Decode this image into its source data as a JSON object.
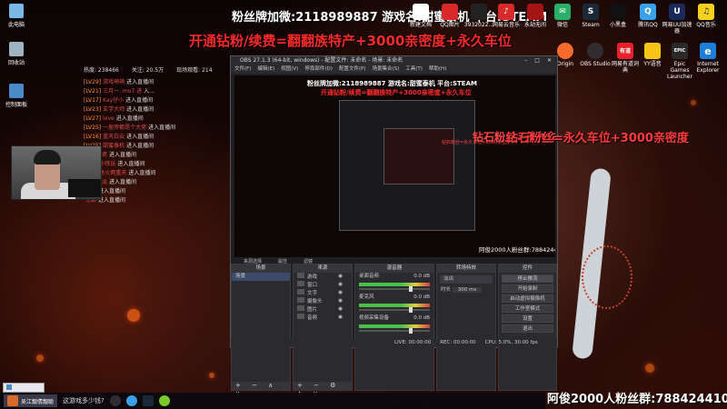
{
  "header": {
    "line1": "粉丝牌加微:2118989887 游戏名:甜蜜泰机 平台:STEAM",
    "line2": "开通钻粉/续费=翻翻族特产+3000亲密度+永久车位"
  },
  "desktop_icons": [
    {
      "label": "此电脑",
      "color": "#7ab8e8"
    },
    {
      "label": "回收站",
      "color": "#9fb3c3"
    },
    {
      "label": "控制面板",
      "color": "#4a8ac8"
    }
  ],
  "app_icons_row1": [
    {
      "label": "新建文档",
      "glyph": "",
      "color": "#ffffff"
    },
    {
      "label": "QQ图片",
      "glyph": "",
      "color": "#d82a2a"
    },
    {
      "label": "3932022...",
      "glyph": "",
      "color": "#222222"
    },
    {
      "label": "网易云音乐",
      "glyph": "♪",
      "color": "#d82a2a"
    },
    {
      "label": "永劫无间",
      "glyph": "",
      "color": "#a31515"
    },
    {
      "label": "微信",
      "glyph": "✉",
      "color": "#2aae67"
    },
    {
      "label": "Steam",
      "glyph": "S",
      "color": "#1b2838"
    },
    {
      "label": "小黑盒",
      "glyph": "",
      "color": "#111111"
    },
    {
      "label": "腾讯QQ",
      "glyph": "Q",
      "color": "#3aa0e8"
    },
    {
      "label": "网易UU加速器",
      "glyph": "U",
      "color": "#1a2a5a"
    },
    {
      "label": "QQ音乐",
      "glyph": "♫",
      "color": "#f5d020"
    }
  ],
  "app_icons_row2": [
    {
      "label": "Origin",
      "glyph": "",
      "color": "#f56c2d"
    },
    {
      "label": "OBS Studio",
      "glyph": "",
      "color": "#302e31"
    },
    {
      "label": "网易有道词典",
      "glyph": "有道",
      "color": "#e8202a"
    },
    {
      "label": "YY语音",
      "glyph": "",
      "color": "#f5c518"
    },
    {
      "label": "Epic Games Launcher",
      "glyph": "EPIC",
      "color": "#2a2a2a"
    },
    {
      "label": "Internet Explorer",
      "glyph": "e",
      "color": "#1e7fd8"
    }
  ],
  "stats": {
    "heat": "热度: 238466",
    "follow": "关注: 20.5万",
    "online": "现场观看: 214"
  },
  "chat": [
    {
      "lvl": "[LV29]",
      "user": "游戏萌萌",
      "msg": "进入直播间"
    },
    {
      "lvl": "[LV21]",
      "user": "三月一. mo7 进",
      "msg": "入..."
    },
    {
      "lvl": "[LV17]",
      "user": "Kay仔小",
      "msg": "进入直播间"
    },
    {
      "lvl": "[LV23]",
      "user": "玄学大师",
      "msg": "进入直播间"
    },
    {
      "lvl": "[LV27]",
      "user": "love",
      "msg": "进入直播间"
    },
    {
      "lvl": "[LV25]",
      "user": "一届帝都是个大佬",
      "msg": "进入直播间"
    },
    {
      "lvl": "[LV16]",
      "user": "蓝天白云",
      "msg": "进入直播间"
    },
    {
      "lvl": "[LV25]",
      "user": "甜蜜泰机",
      "msg": "进入直播间"
    },
    {
      "lvl": "",
      "user": "主播大佬",
      "msg": "进入直播间"
    },
    {
      "lvl": "[LV7]",
      "user": "小铁玩",
      "msg": "进入直播间"
    },
    {
      "lvl": "[LV8]",
      "user": "冰火两重天",
      "msg": "进入直播间"
    },
    {
      "lvl": "",
      "user": "风清云淡",
      "msg": "进入直播间"
    },
    {
      "lvl": "",
      "user": "奶茶",
      "msg": "进入直播间"
    },
    {
      "lvl": "",
      "user": "无聊",
      "msg": "进入直播间"
    }
  ],
  "obs": {
    "title": "OBS 27.1.3 (64-bit, windows) - 配置文件: 未命名 - 场景: 未命名",
    "menu": [
      "文件(F)",
      "编辑(E)",
      "视图(V)",
      "停靠部件(D)",
      "配置文件(P)",
      "场景集合(S)",
      "工具(T)",
      "帮助(H)"
    ],
    "preview_title": "粉丝牌加微:2118989887 游戏名:甜蜜泰机 平台:STEAM",
    "preview_red": "开通钻粉/续费=翻翻族特产+3000亲密度+永久车位",
    "preview_diamond": "钻石粉丝=永久车位+3000亲密度",
    "preview_fans": "阿俊2000人粉丝群:788424410",
    "tabs": [
      "来源选择",
      "属性",
      "滤镜"
    ],
    "scenes_header": "场景",
    "scenes": [
      "场景"
    ],
    "sources_header": "来源",
    "sources": [
      "游戏",
      "窗口",
      "文字",
      "摄像头",
      "图片",
      "音频"
    ],
    "mixer_header": "混音器",
    "mixer_channels": [
      {
        "name": "桌面音频",
        "db": "0.0 dB"
      },
      {
        "name": "麦克风",
        "db": "0.0 dB"
      },
      {
        "name": "视频采集设备",
        "db": "0.0 dB"
      }
    ],
    "transitions_header": "转场特效",
    "transition": "淡出",
    "duration_label": "时长",
    "duration": "300 ms",
    "controls_header": "控件",
    "controls": [
      "停止推流",
      "开始录制",
      "启动虚拟摄像机",
      "工作室模式",
      "设置",
      "退出"
    ],
    "status": {
      "live": "LIVE: 00:00:00",
      "rec": "REC: 00:00:00",
      "cpu": "CPU: 5.0%, 30.00 fps"
    }
  },
  "overlay": {
    "diamond": "钻石粉丝=永久车位+3000亲密度",
    "fans": "阿俊2000人粉丝群:788424410"
  },
  "taskbar": {
    "mini_window": "",
    "app_label": "吴江靓倩靓聪",
    "search": "这游戏多少钱?"
  }
}
